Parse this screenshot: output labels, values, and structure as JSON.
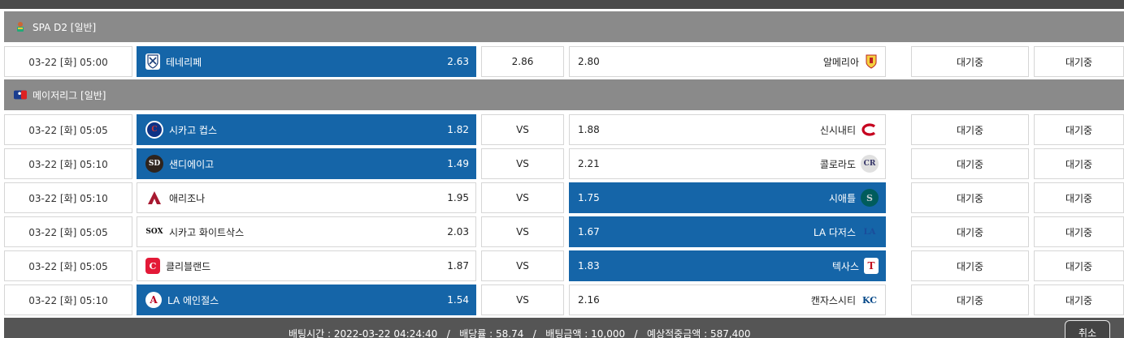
{
  "leagues": [
    {
      "name": "SPA D2 [일반]",
      "icon": "spain-flag-icon"
    },
    {
      "name": "메이저리그 [일반]",
      "icon": "mlb-logo-icon"
    }
  ],
  "matches": [
    {
      "time": "03-22 [화] 05:00",
      "home": "테네리페",
      "home_odd": "2.63",
      "draw": "2.86",
      "away_odd": "2.80",
      "away": "알메리아",
      "status1": "대기중",
      "status2": "대기중"
    },
    {
      "time": "03-22 [화] 05:05",
      "home": "시카고 컵스",
      "home_odd": "1.82",
      "draw": "VS",
      "away_odd": "1.88",
      "away": "신시내티",
      "status1": "대기중",
      "status2": "대기중"
    },
    {
      "time": "03-22 [화] 05:10",
      "home": "샌디에이고",
      "home_odd": "1.49",
      "draw": "VS",
      "away_odd": "2.21",
      "away": "콜로라도",
      "status1": "대기중",
      "status2": "대기중"
    },
    {
      "time": "03-22 [화] 05:10",
      "home": "애리조나",
      "home_odd": "1.95",
      "draw": "VS",
      "away_odd": "1.75",
      "away": "시애틀",
      "status1": "대기중",
      "status2": "대기중"
    },
    {
      "time": "03-22 [화] 05:05",
      "home": "시카고 화이트삭스",
      "home_odd": "2.03",
      "draw": "VS",
      "away_odd": "1.67",
      "away": "LA 다저스",
      "status1": "대기중",
      "status2": "대기중"
    },
    {
      "time": "03-22 [화] 05:05",
      "home": "클리블랜드",
      "home_odd": "1.87",
      "draw": "VS",
      "away_odd": "1.83",
      "away": "텍사스",
      "status1": "대기중",
      "status2": "대기중"
    },
    {
      "time": "03-22 [화] 05:10",
      "home": "LA 에인절스",
      "home_odd": "1.54",
      "draw": "VS",
      "away_odd": "2.16",
      "away": "캔자스시티",
      "status1": "대기중",
      "status2": "대기중"
    }
  ],
  "footer": {
    "summary": "배팅시간 : 2022-03-22 04:24:40   /   배당률 : 58.74   /   배팅금액 : 10,000   /   예상적중금액 : 587,400",
    "cancel_label": "취소"
  },
  "colors": {
    "selected": "#1565a8",
    "league_bar": "#8a8a8a",
    "footer": "#555555"
  }
}
